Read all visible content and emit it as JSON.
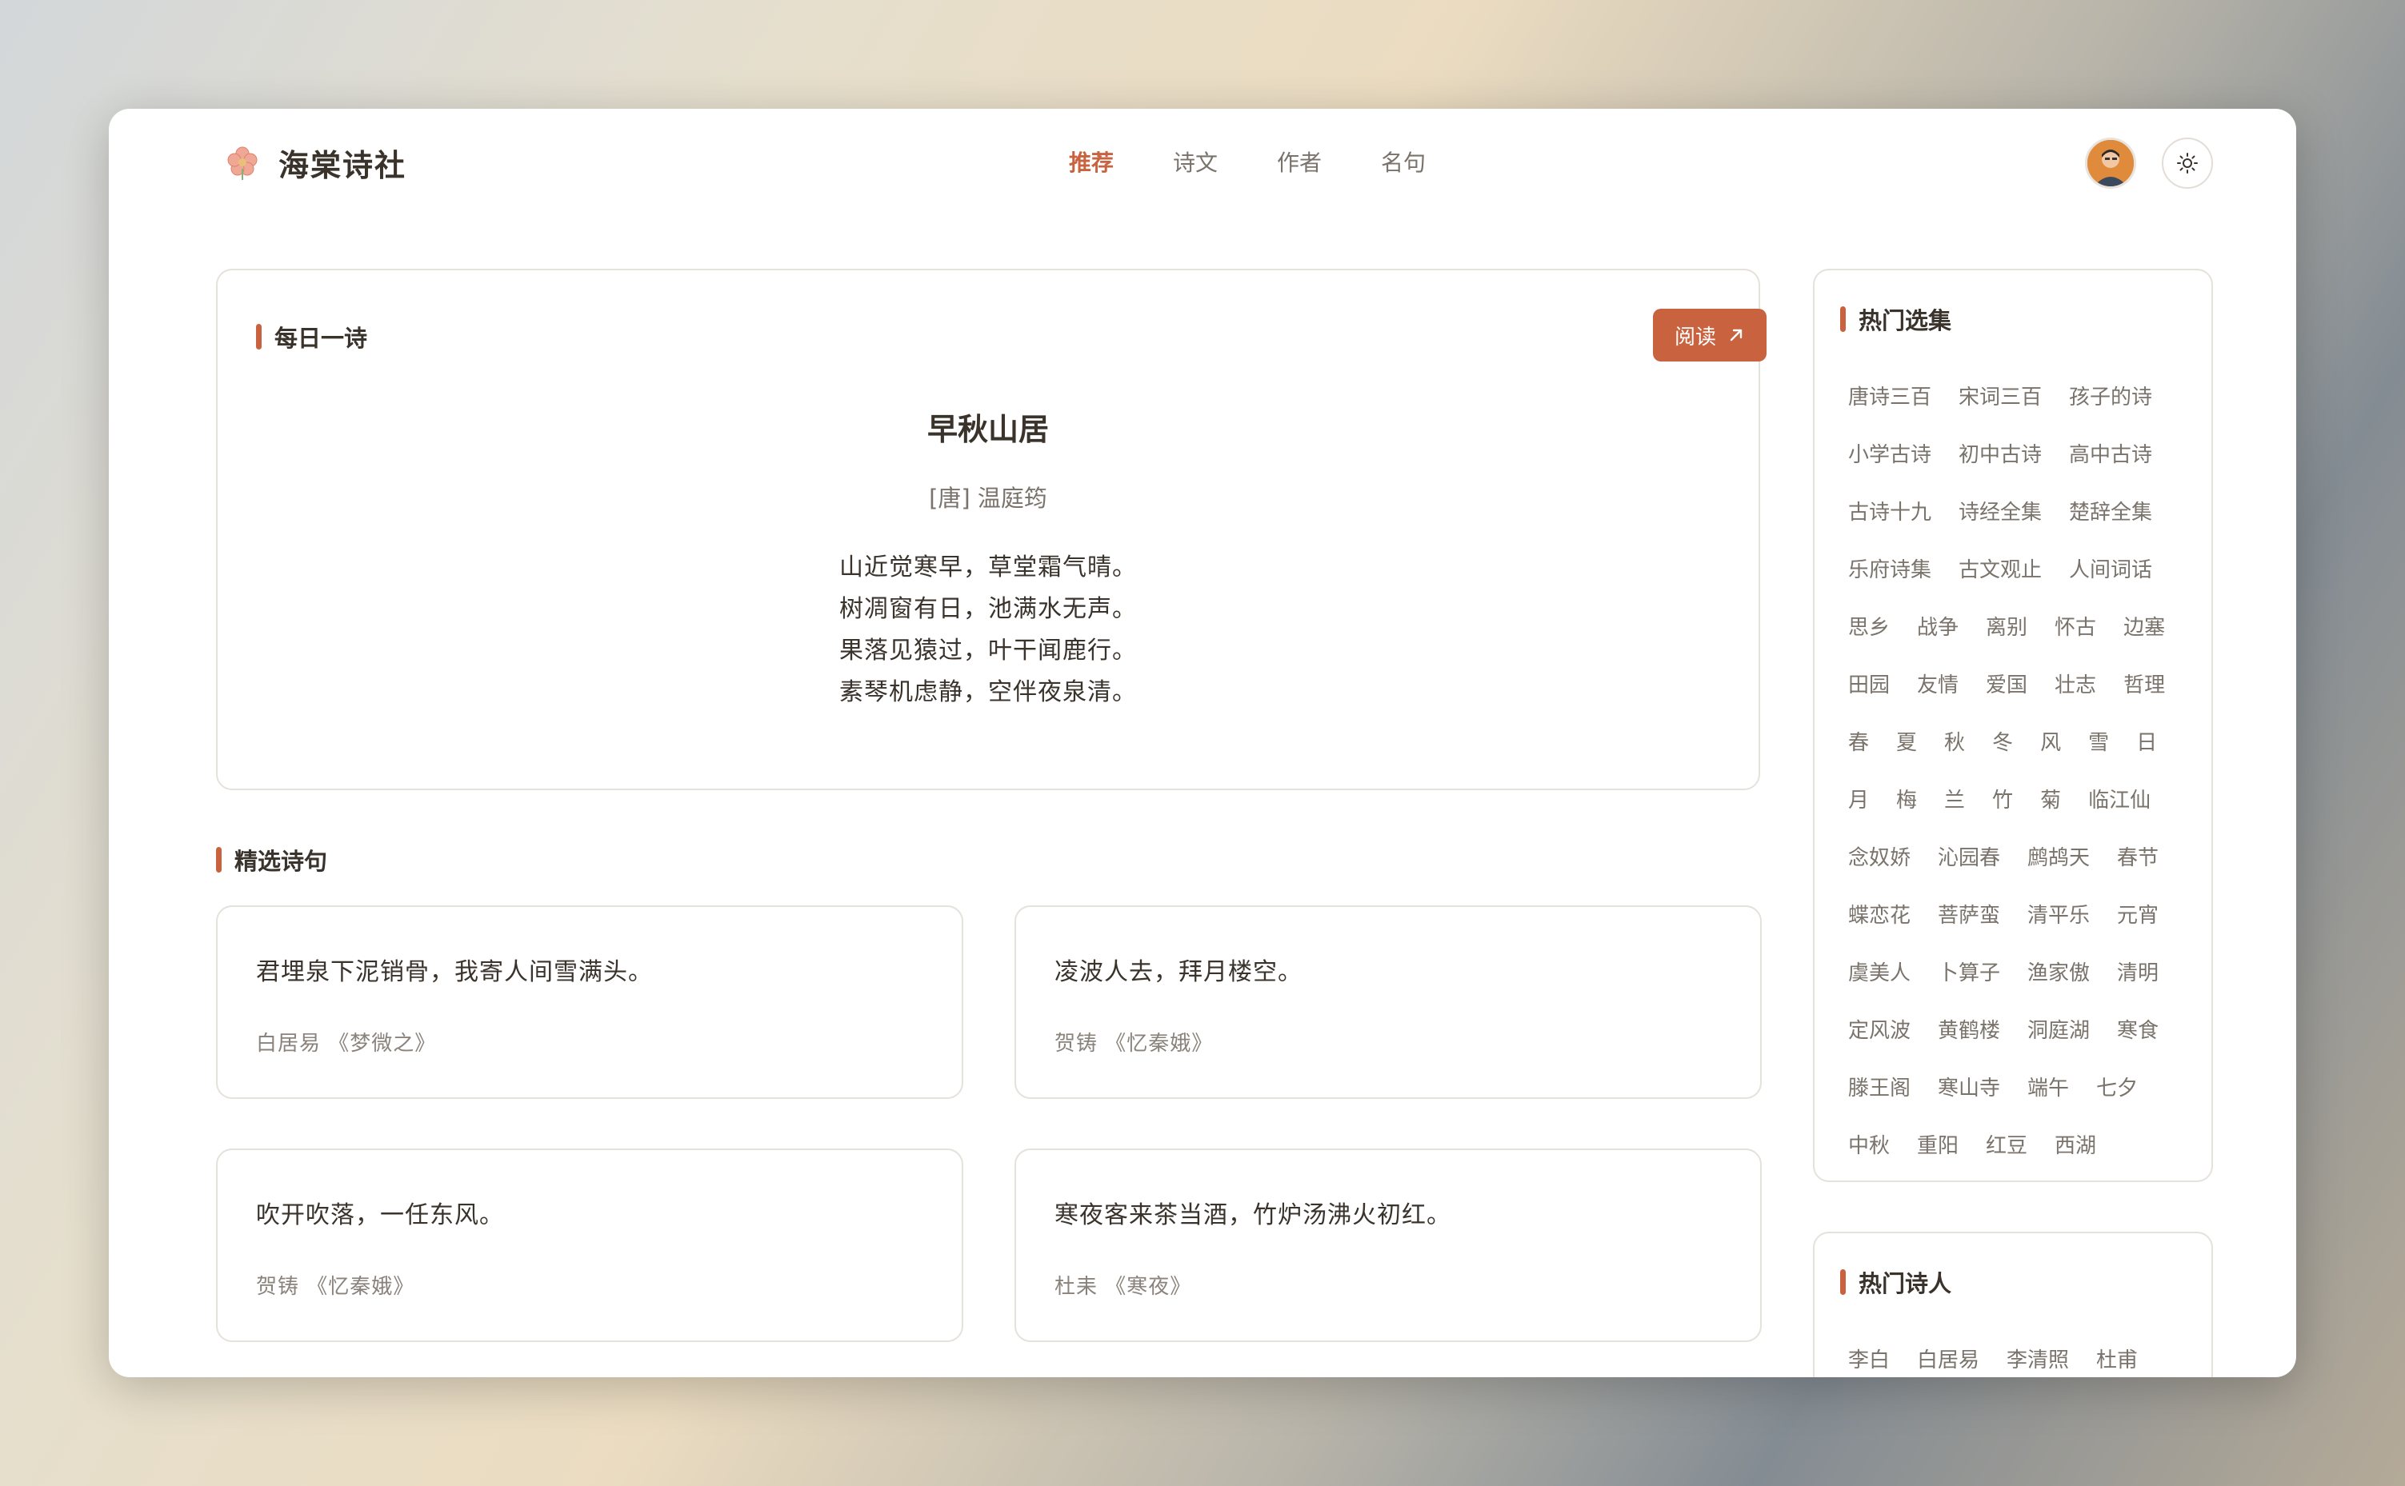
{
  "brand": {
    "name": "海棠诗社"
  },
  "nav": {
    "items": [
      "推荐",
      "诗文",
      "作者",
      "名句"
    ],
    "active": "推荐"
  },
  "daily": {
    "section_title": "每日一诗",
    "read_button": "阅读",
    "title": "早秋山居",
    "author": "[唐]  温庭筠",
    "lines": [
      "山近觉寒早，草堂霜气晴。",
      "树凋窗有日，池满水无声。",
      "果落见猿过，叶干闻鹿行。",
      "素琴机虑静，空伴夜泉清。"
    ]
  },
  "featured": {
    "section_title": "精选诗句",
    "quotes": [
      {
        "text": "君埋泉下泥销骨，我寄人间雪满头。",
        "source": "白居易 《梦微之》"
      },
      {
        "text": "凌波人去，拜月楼空。",
        "source": "贺铸 《忆秦娥》"
      },
      {
        "text": "吹开吹落，一任东风。",
        "source": "贺铸 《忆秦娥》"
      },
      {
        "text": "寒夜客来茶当酒，竹炉汤沸火初红。",
        "source": "杜耒 《寒夜》"
      }
    ]
  },
  "collections": {
    "section_title": "热门选集",
    "rows": [
      [
        "唐诗三百",
        "宋词三百",
        "孩子的诗"
      ],
      [
        "小学古诗",
        "初中古诗",
        "高中古诗"
      ],
      [
        "古诗十九",
        "诗经全集",
        "楚辞全集"
      ],
      [
        "乐府诗集",
        "古文观止",
        "人间词话"
      ],
      [
        "思乡",
        "战争",
        "离别",
        "怀古",
        "边塞"
      ],
      [
        "田园",
        "友情",
        "爱国",
        "壮志",
        "哲理"
      ],
      [
        "春",
        "夏",
        "秋",
        "冬",
        "风",
        "雪",
        "日"
      ],
      [
        "月",
        "梅",
        "兰",
        "竹",
        "菊",
        "临江仙"
      ],
      [
        "念奴娇",
        "沁园春",
        "鹧鸪天",
        "春节"
      ],
      [
        "蝶恋花",
        "菩萨蛮",
        "清平乐",
        "元宵"
      ],
      [
        "虞美人",
        "卜算子",
        "渔家傲",
        "清明"
      ],
      [
        "定风波",
        "黄鹤楼",
        "洞庭湖",
        "寒食"
      ],
      [
        "滕王阁",
        "寒山寺",
        "端午",
        "七夕"
      ],
      [
        "中秋",
        "重阳",
        "红豆",
        "西湖"
      ]
    ]
  },
  "poets": {
    "section_title": "热门诗人",
    "names": [
      "李白",
      "白居易",
      "李清照",
      "杜甫"
    ]
  },
  "colors": {
    "accent": "#c8623f",
    "text": "#3a332c",
    "muted": "#7a736b"
  },
  "icons": {
    "brand": "begonia-flower-icon",
    "theme": "sun-icon",
    "read": "arrow-up-right-icon"
  }
}
